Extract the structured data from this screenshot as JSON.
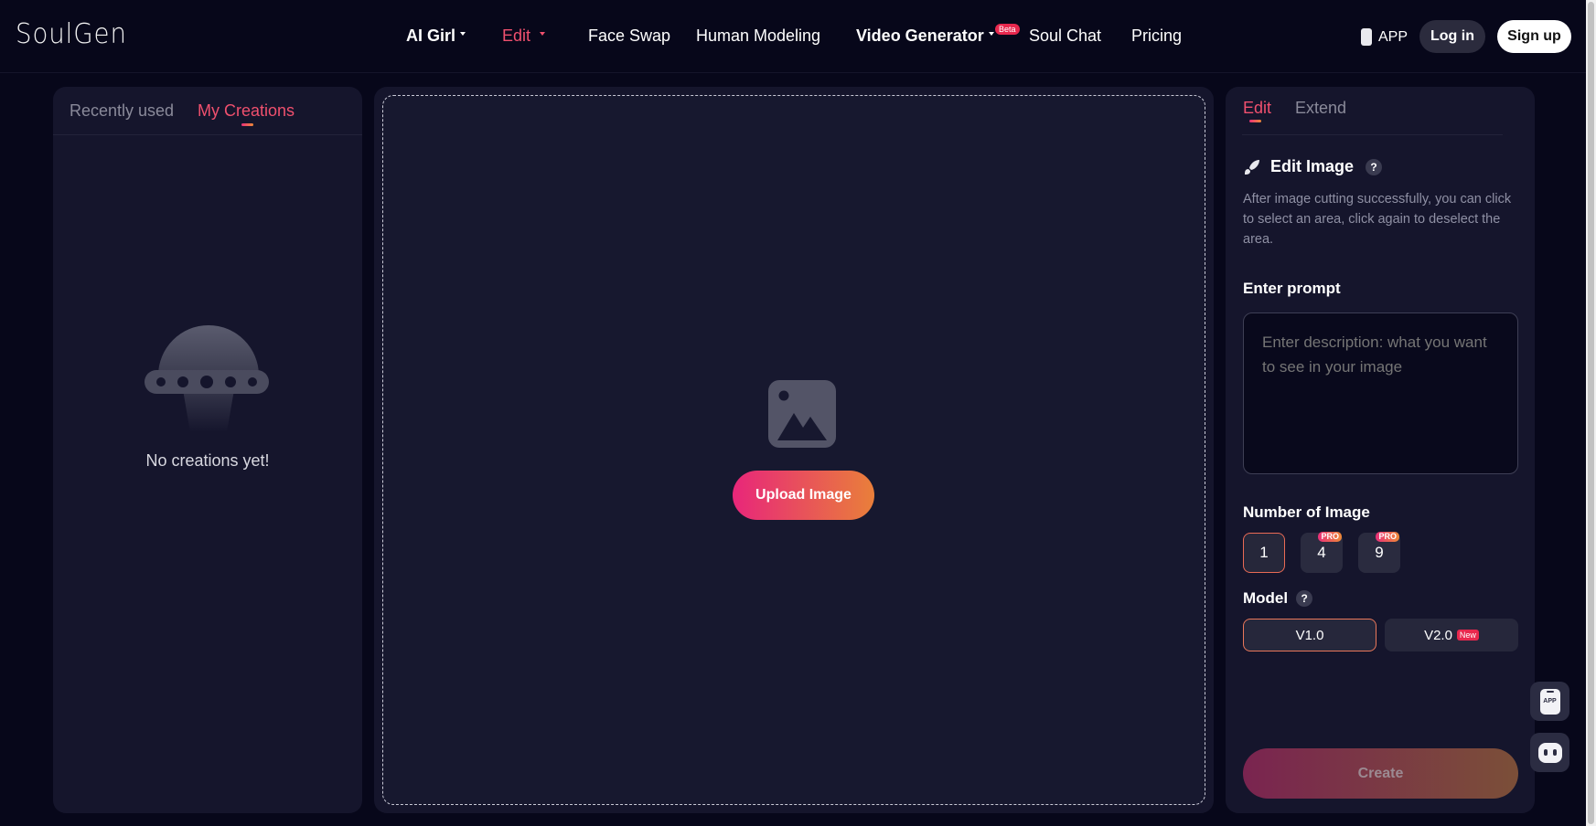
{
  "brand": {
    "logo": "SoulGen"
  },
  "nav": {
    "items": [
      {
        "label": "AI Girl",
        "dropdown": true
      },
      {
        "label": "Edit",
        "dropdown": true,
        "active": true
      },
      {
        "label": "Face Swap"
      },
      {
        "label": "Human Modeling"
      },
      {
        "label": "Video Generator",
        "dropdown": true,
        "badge": "Beta"
      },
      {
        "label": "Soul Chat"
      },
      {
        "label": "Pricing"
      }
    ],
    "app_label": "APP",
    "login_label": "Log in",
    "signup_label": "Sign up"
  },
  "left_panel": {
    "tabs": [
      {
        "label": "Recently used",
        "active": false
      },
      {
        "label": "My Creations",
        "active": true
      }
    ],
    "empty_message": "No creations yet!"
  },
  "center_panel": {
    "upload_label": "Upload Image"
  },
  "right_panel": {
    "tabs": [
      {
        "label": "Edit",
        "active": true
      },
      {
        "label": "Extend",
        "active": false
      }
    ],
    "edit_title": "Edit Image",
    "help_glyph": "?",
    "edit_description": "After image cutting successfully, you can click to select an area, click again to deselect the area.",
    "prompt_label": "Enter prompt",
    "prompt_placeholder": "Enter description: what you want to see in your image",
    "number_label": "Number of Image",
    "number_options": [
      {
        "value": "1",
        "selected": true,
        "badge": ""
      },
      {
        "value": "4",
        "selected": false,
        "badge": "PRO"
      },
      {
        "value": "9",
        "selected": false,
        "badge": "PRO"
      }
    ],
    "model_label": "Model",
    "model_options": [
      {
        "label": "V1.0",
        "selected": true,
        "badge": ""
      },
      {
        "label": "V2.0",
        "selected": false,
        "badge": "New"
      }
    ],
    "create_label": "Create"
  },
  "floating": {
    "app_icon_text": "APP",
    "chat_icon": "chat-bot-icon"
  },
  "colors": {
    "background": "#07071a",
    "panel": "#15152c",
    "accent_pink": "#e8267a",
    "accent_orange": "#e97f3a",
    "active_text": "#f0506e"
  }
}
